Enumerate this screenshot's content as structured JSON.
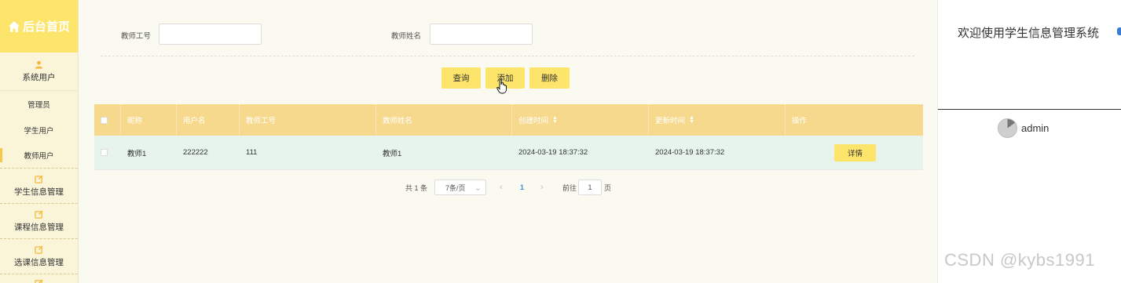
{
  "sidebar": {
    "home_label": "后台首页",
    "system_group": "系统用户",
    "sub_items": [
      "管理员",
      "学生用户",
      "教师用户"
    ],
    "groups": [
      "学生信息管理",
      "课程信息管理",
      "选课信息管理"
    ]
  },
  "search": {
    "teacher_no_label": "教师工号",
    "teacher_no_value": "",
    "teacher_name_label": "教师姓名",
    "teacher_name_value": ""
  },
  "actions": {
    "query": "查询",
    "add": "添加",
    "delete": "删除"
  },
  "table": {
    "headers": [
      "昵称",
      "用户名",
      "教师工号",
      "教师姓名",
      "创建时间",
      "更新时间",
      "操作"
    ],
    "rows": [
      {
        "nickname": "教师1",
        "username": "222222",
        "teacher_no": "111",
        "teacher_name": "教师1",
        "created": "2024-03-19 18:37:32",
        "updated": "2024-03-19 18:37:32",
        "action": "详情"
      }
    ]
  },
  "pagination": {
    "total": "共 1 条",
    "page_size": "7条/页",
    "current_page": "1",
    "goto_label": "前往",
    "goto_value": "1",
    "page_unit": "页"
  },
  "right_panel": {
    "welcome": "欢迎使用学生信息管理系统",
    "username": "admin"
  },
  "watermark": "CSDN @kybs1991",
  "colors": {
    "accent": "#fde46b",
    "header_bg": "#f6d98c",
    "row_bg": "#e6f4ec",
    "sidebar_bg": "#faf5d9",
    "icon": "#f6b73c"
  }
}
